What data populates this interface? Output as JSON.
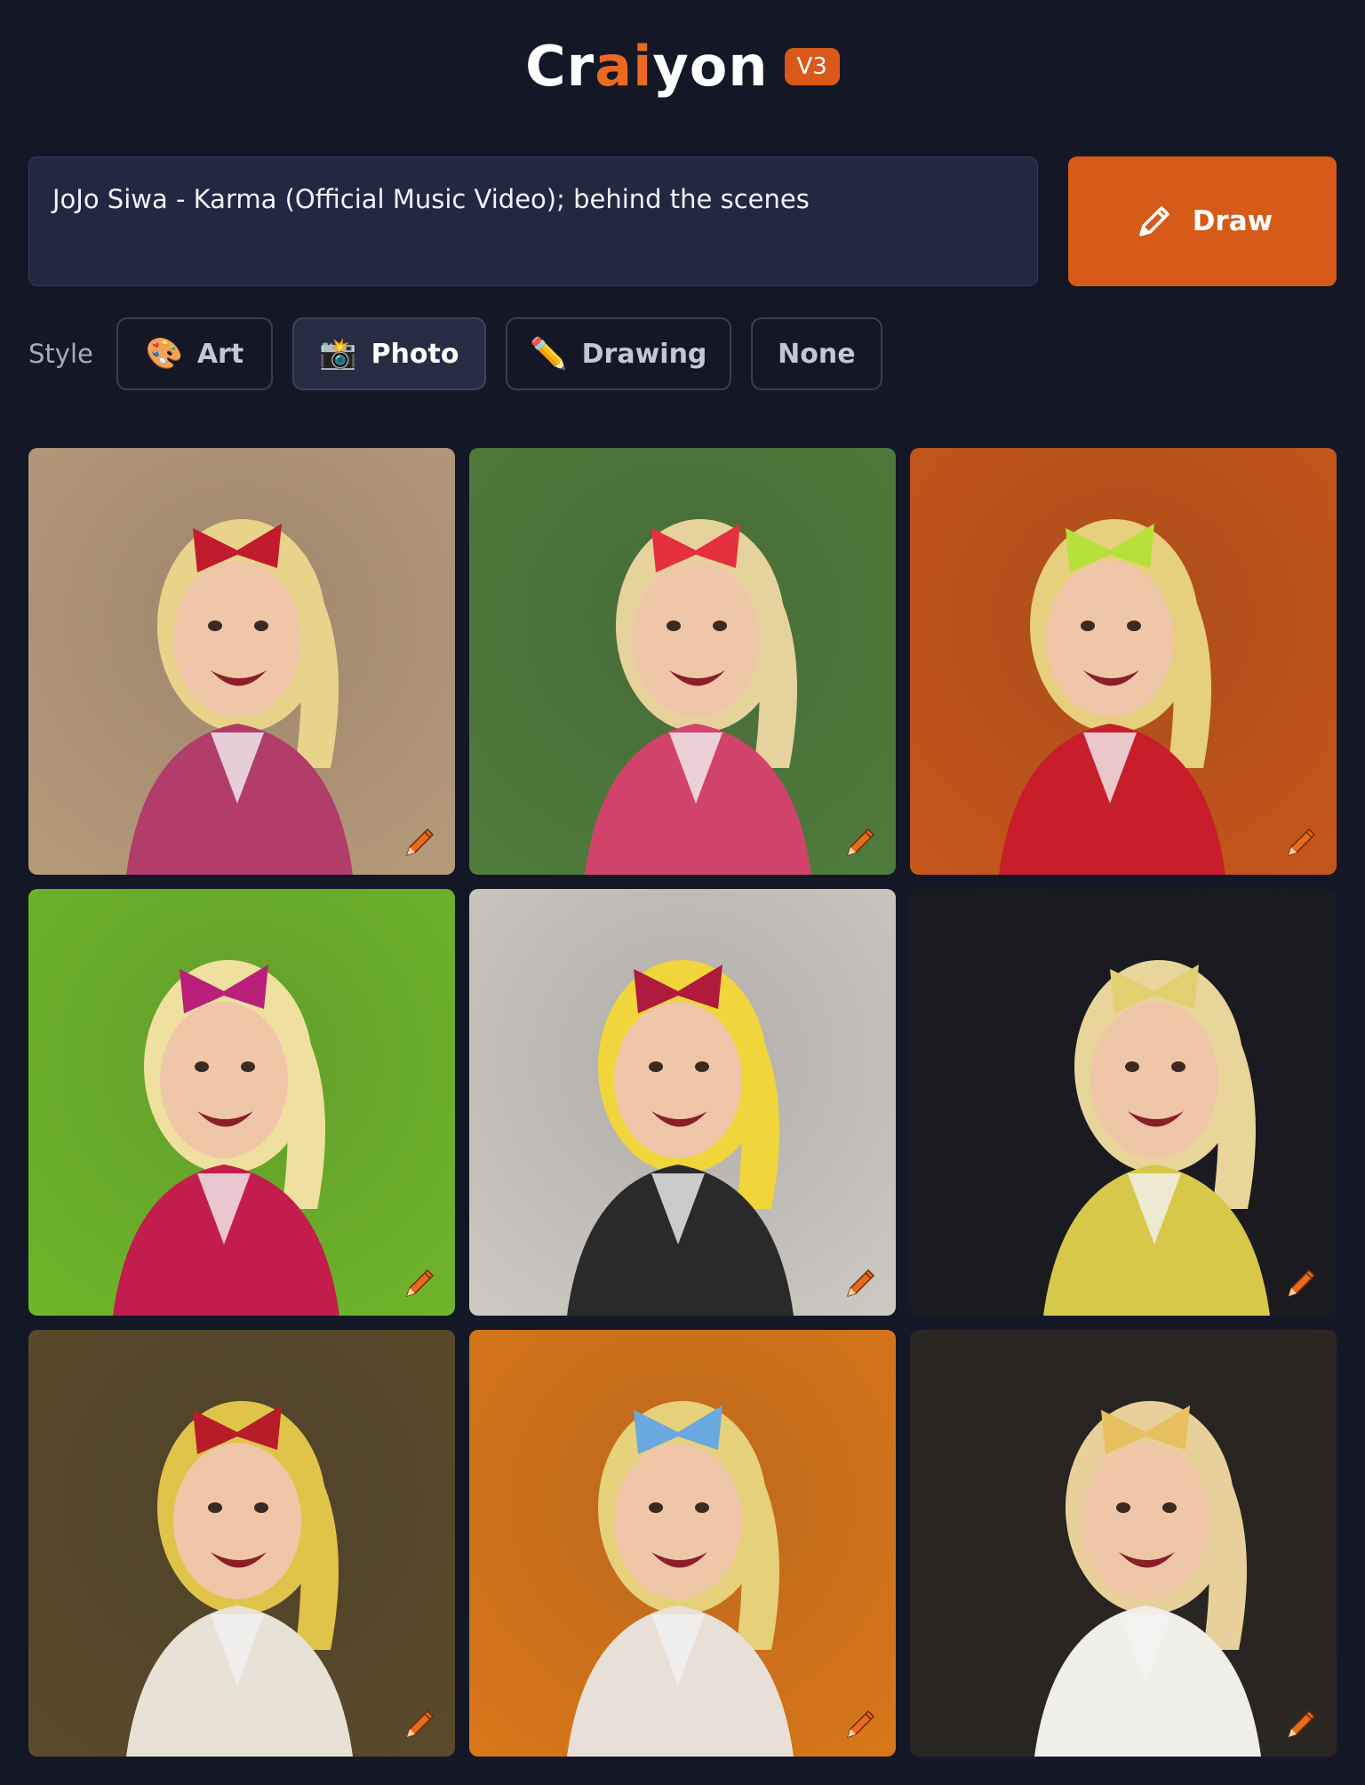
{
  "header": {
    "logo_pre": "Cr",
    "logo_accent1": "a",
    "logo_accent2": "i",
    "logo_post": "yon",
    "version": "V3"
  },
  "prompt": {
    "value": "JoJo Siwa - Karma (Official Music Video); behind the scenes"
  },
  "draw_button": {
    "label": "Draw",
    "icon": "pencil-icon"
  },
  "style": {
    "label": "Style",
    "options": [
      {
        "label": "Art",
        "icon": "🎨",
        "selected": false
      },
      {
        "label": "Photo",
        "icon": "📸",
        "selected": true
      },
      {
        "label": "Drawing",
        "icon": "✏️",
        "selected": false
      },
      {
        "label": "None",
        "icon": "",
        "selected": false
      }
    ]
  },
  "results": {
    "images": [
      {
        "bg": "#b59a7a",
        "accent": "#c21b2e",
        "hair": "#e7d48a",
        "outfit": "#b23c6a"
      },
      {
        "bg": "#4f7b3b",
        "accent": "#e63040",
        "hair": "#e6d39c",
        "outfit": "#d2436b"
      },
      {
        "bg": "#c5561b",
        "accent": "#b7e03a",
        "hair": "#e6cf7d",
        "outfit": "#c81d2b"
      },
      {
        "bg": "#6fb52a",
        "accent": "#b8207a",
        "hair": "#f0e0a0",
        "outfit": "#c21d4d"
      },
      {
        "bg": "#ccc8c2",
        "accent": "#b01a3c",
        "hair": "#f0d63a",
        "outfit": "#2a2a2a"
      },
      {
        "bg": "#1b1b1f",
        "accent": "#e0d070",
        "hair": "#e8d59a",
        "outfit": "#d8c84a"
      },
      {
        "bg": "#5a4a2a",
        "accent": "#b81c28",
        "hair": "#e0c44a",
        "outfit": "#e8e2d6"
      },
      {
        "bg": "#d8761a",
        "accent": "#6aa8e0",
        "hair": "#e6d07a",
        "outfit": "#e8e0d6"
      },
      {
        "bg": "#2a2622",
        "accent": "#e8c060",
        "hair": "#e8d09a",
        "outfit": "#f0eee8"
      }
    ]
  },
  "colors": {
    "background": "#141826",
    "accent": "#d65a18"
  }
}
